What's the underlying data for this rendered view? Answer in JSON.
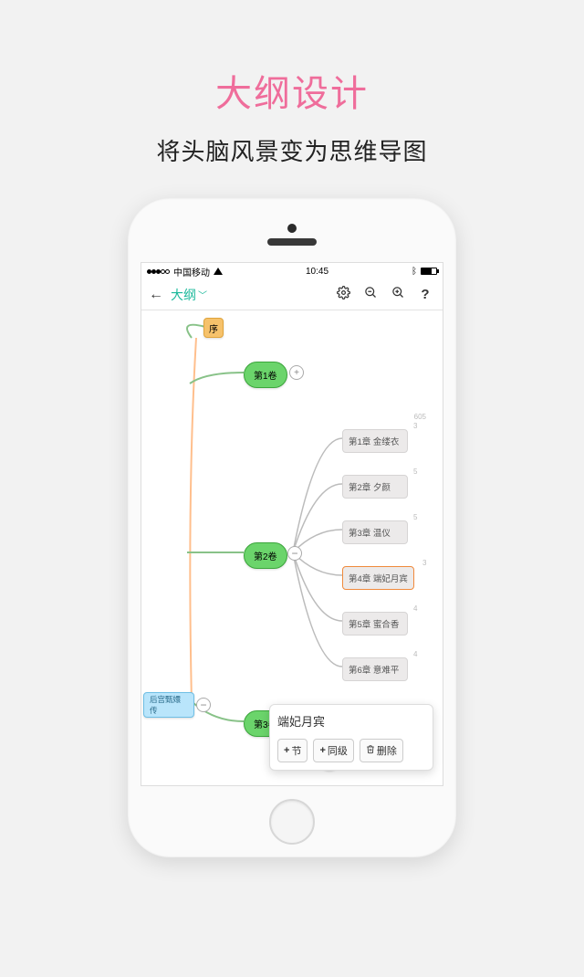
{
  "promo": {
    "title": "大纲设计",
    "subtitle": "将头脑风景变为思维导图"
  },
  "statusbar": {
    "carrier": "中国移动",
    "time": "10:45"
  },
  "toolbar": {
    "title": "大纲",
    "icons": [
      "settings",
      "zoom-out",
      "zoom-in",
      "help"
    ]
  },
  "nodes": {
    "root": {
      "label": "后宫甄嬛传",
      "bg": "#9bd8f6",
      "border": "#5fb9e6"
    },
    "preface": {
      "label": "序",
      "bg": "#f6c26b",
      "border": "#e0a43c"
    },
    "vol1": {
      "label": "第1卷",
      "bg": "#6bd46b",
      "border": "#3ca63c"
    },
    "vol2": {
      "label": "第2卷",
      "bg": "#6bd46b",
      "border": "#3ca63c"
    },
    "vol3": {
      "label": "第3卷",
      "bg": "#6bd46b",
      "border": "#3ca63c"
    },
    "vol2_count": "605",
    "chapters": [
      {
        "label": "第1章 金缕衣",
        "badge": "3"
      },
      {
        "label": "第2章 夕颜",
        "badge": "5"
      },
      {
        "label": "第3章 温仪",
        "badge": "5"
      },
      {
        "label": "第4章 端妃月宾",
        "selected": true,
        "badge": "3"
      },
      {
        "label": "第5章 蜜合香",
        "badge": "4"
      },
      {
        "label": "第6章 意难平",
        "badge": "4"
      }
    ]
  },
  "popup": {
    "title": "端妃月宾",
    "buttons": {
      "child": "节",
      "sibling": "同级",
      "delete": "删除"
    }
  }
}
